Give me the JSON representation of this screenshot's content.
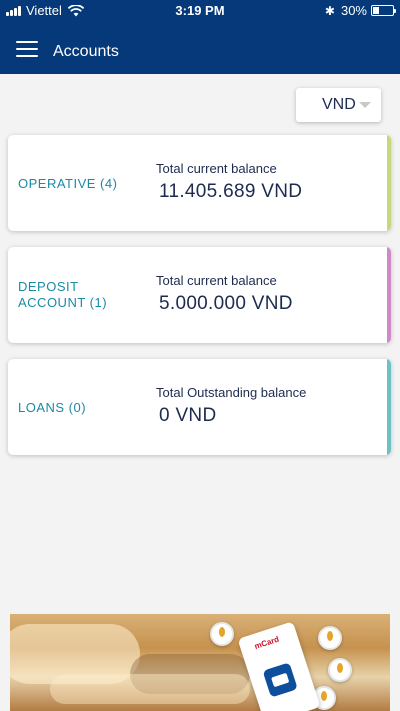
{
  "status_bar": {
    "carrier": "Viettel",
    "time": "3:19 PM",
    "battery": "30%",
    "battery_level": 0.3
  },
  "nav": {
    "title": "Accounts",
    "menu_icon": "hamburger-menu-icon"
  },
  "currency": {
    "selected": "VND"
  },
  "accounts": [
    {
      "name": "OPERATIVE (4)",
      "balance_label": "Total current balance",
      "balance_value": "11.405.689 VND",
      "accent": "#c6d97a"
    },
    {
      "name": "DEPOSIT ACCOUNT (1)",
      "balance_label": "Total current balance",
      "balance_value": "5.000.000 VND",
      "accent": "#cf8ac6"
    },
    {
      "name": "LOANS (0)",
      "balance_label": "Total Outstanding balance",
      "balance_value": "0 VND",
      "accent": "#6cc2c2"
    }
  ],
  "banner": {
    "card_label": "mCard"
  },
  "colors": {
    "header": "#05397a",
    "accent_text": "#1b8aa5",
    "body_text": "#1d2b4f"
  }
}
